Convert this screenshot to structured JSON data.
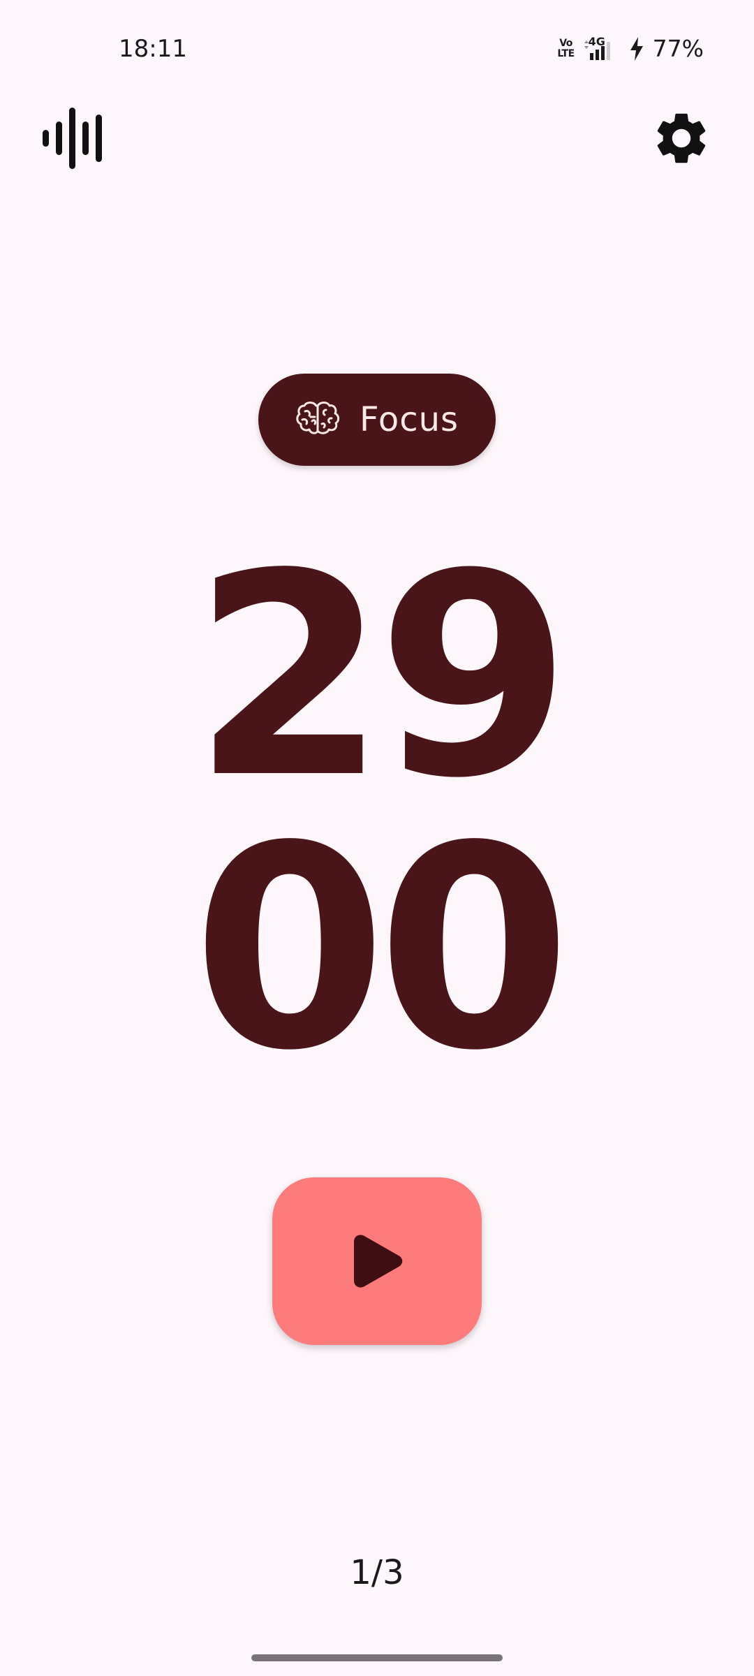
{
  "status_bar": {
    "time": "18:11",
    "volte_line1": "Vo",
    "volte_line2": "LTE",
    "network": "4G",
    "battery": "77%"
  },
  "toolbar": {
    "sound_icon": "sound-wave-icon",
    "settings_icon": "gear-icon"
  },
  "mode": {
    "label": "Focus",
    "icon": "brain-icon"
  },
  "timer": {
    "minutes": "29",
    "seconds": "00"
  },
  "controls": {
    "play_icon": "play-icon"
  },
  "session": {
    "indicator": "1/3"
  },
  "colors": {
    "background": "#fdf7fc",
    "primary": "#4a1518",
    "play_button": "#fe7b7b",
    "chip_text": "#fde8ea"
  }
}
